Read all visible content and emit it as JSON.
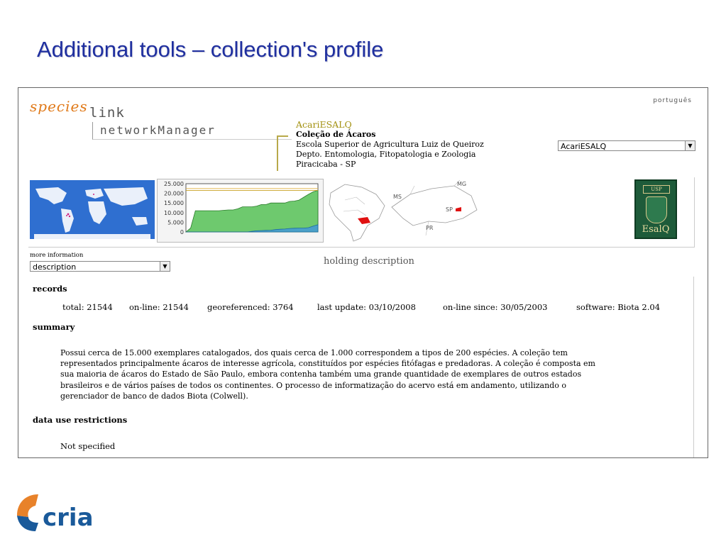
{
  "slide": {
    "title": "Additional tools – collection's profile"
  },
  "header": {
    "logo_species": "species",
    "logo_link": "link",
    "logo_network_manager": "networkManager",
    "language_link": "português"
  },
  "collection": {
    "acronym": "AcariESALQ",
    "name": "Coleção de Ácaros",
    "institution": "Escola Superior de Agricultura Luiz de Queiroz",
    "department": "Depto. Entomologia, Fitopatologia e Zoologia",
    "city": "Piracicaba - SP",
    "selector_value": "AcariESALQ"
  },
  "chart": {
    "y_ticks": [
      "25.000",
      "20.000",
      "15.000",
      "10.000",
      "5.000",
      "0"
    ]
  },
  "chart_data": {
    "type": "area",
    "title": "",
    "xlabel": "",
    "ylabel": "",
    "ylim": [
      0,
      25000
    ],
    "grid": false,
    "series": [
      {
        "values": [
          0,
          2000,
          11000,
          11000,
          11000,
          11000,
          11000,
          11000,
          11200,
          11400,
          11400,
          12000,
          13000,
          13000,
          13000,
          13400,
          14200,
          14200,
          15000,
          15000,
          15000,
          15000,
          15800,
          16000,
          16500,
          18000,
          19500,
          20800,
          21544
        ],
        "color": "#6ec96e"
      },
      {
        "values": [
          0,
          0,
          0,
          0,
          0,
          0,
          0,
          0,
          0,
          0,
          0,
          0,
          0,
          0,
          300,
          600,
          700,
          800,
          900,
          1200,
          1400,
          1500,
          1800,
          1900,
          2000,
          2000,
          2200,
          3000,
          3764
        ],
        "color": "#4aa0c8"
      }
    ],
    "reference_lines": [
      21544,
      22500
    ]
  },
  "maps": {
    "labels": {
      "ms": "MS",
      "mg": "MG",
      "sp": "SP",
      "pr": "PR"
    },
    "esalq_logo": {
      "usp": "USP",
      "text": "EsalQ"
    }
  },
  "more_information": {
    "label": "more information",
    "selector_value": "description"
  },
  "holding": {
    "title": "holding description",
    "records_heading": "records",
    "records": {
      "total": "total: 21544",
      "online": "on-line: 21544",
      "georeferenced": "georeferenced: 3764",
      "last_update": "last update: 03/10/2008",
      "online_since": "on-line since: 30/05/2003",
      "software": "software: Biota 2.04"
    },
    "summary_heading": "summary",
    "summary_lines": [
      "Possui cerca de 15.000 exemplares catalogados, dos quais cerca de 1.000 correspondem a tipos de 200 espécies. A coleção tem",
      "representados principalmente ácaros de interesse agrícola, constituídos por espécies fitófagas e predadoras. A coleção é composta em",
      "sua maioria de ácaros do Estado de São Paulo, embora contenha também uma grande quantidade de exemplares de outros estados",
      "brasileiros e de vários países de todos os continentes. O processo de informatização do acervo está em andamento, utilizando o",
      "gerenciador de banco de dados Biota (Colwell)."
    ],
    "restrictions_heading": "data use restrictions",
    "restrictions_value": "Not specified"
  },
  "footer": {
    "logo_text": "cria"
  },
  "colors": {
    "title": "#1f2f9f",
    "acronym": "#a39110",
    "logo_orange": "#e07a1a",
    "cria_blue": "#1a5a9a",
    "cria_orange": "#e8822a"
  }
}
